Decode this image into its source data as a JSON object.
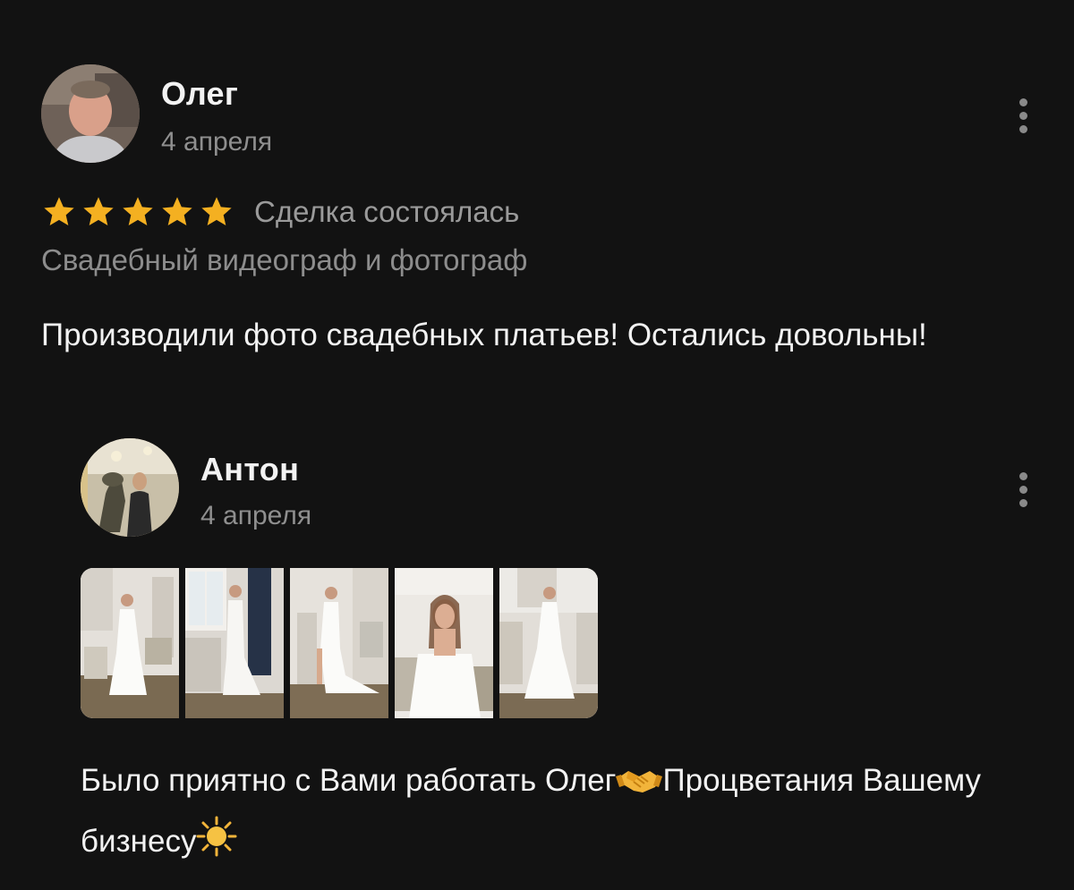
{
  "review": {
    "author_name": "Олег",
    "date": "4 апреля",
    "rating": 5,
    "rating_max": 5,
    "deal_status": "Сделка состоялась",
    "service": "Свадебный видеограф и фотограф",
    "text": "Производили фото свадебных платьев! Остались довольны!"
  },
  "reply": {
    "author_name": "Антон",
    "date": "4 апреля",
    "photo_count": 5,
    "text_part1": "Было приятно с Вами работать Олег",
    "emoji1": "handshake-icon",
    "text_part2": "Процветания Вашему бизнесу",
    "emoji2": "sun-icon"
  },
  "colors": {
    "background": "#121212",
    "star": "#f4b021",
    "secondary_text": "#8f8f8f",
    "primary_text": "#f2f2f2"
  }
}
